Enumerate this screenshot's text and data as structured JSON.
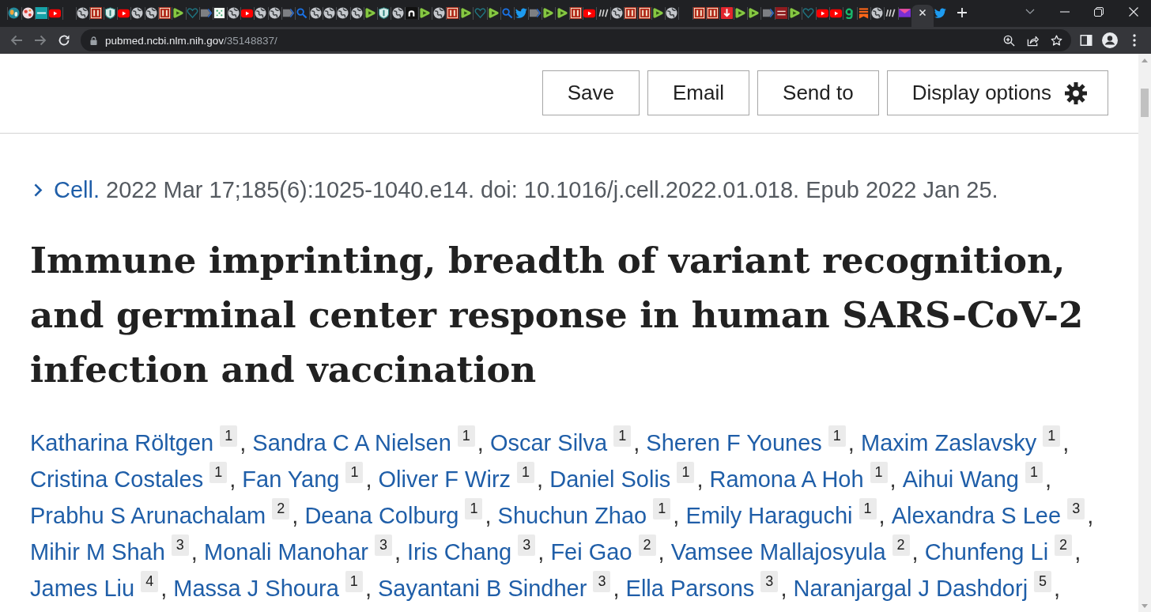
{
  "tabs": [
    {
      "kind": "earth",
      "selected": false
    },
    {
      "kind": "splash",
      "selected": false
    },
    {
      "kind": "stat",
      "selected": false
    },
    {
      "kind": "youtube",
      "selected": false
    },
    {
      "kind": "blank",
      "selected": false
    },
    {
      "kind": "globe",
      "selected": false
    },
    {
      "kind": "bi",
      "selected": false
    },
    {
      "kind": "shield",
      "selected": false
    },
    {
      "kind": "youtube",
      "selected": false
    },
    {
      "kind": "globe",
      "selected": false
    },
    {
      "kind": "globe",
      "selected": false
    },
    {
      "kind": "bi",
      "selected": false
    },
    {
      "kind": "rumble",
      "selected": false
    },
    {
      "kind": "heart",
      "selected": false
    },
    {
      "kind": "tag",
      "selected": false
    },
    {
      "kind": "dots",
      "selected": false
    },
    {
      "kind": "globe",
      "selected": false
    },
    {
      "kind": "youtube",
      "selected": false
    },
    {
      "kind": "globe",
      "selected": false
    },
    {
      "kind": "globe",
      "selected": false
    },
    {
      "kind": "tag",
      "selected": false
    },
    {
      "kind": "magnifier",
      "selected": false
    },
    {
      "kind": "globe",
      "selected": false
    },
    {
      "kind": "globe",
      "selected": false
    },
    {
      "kind": "globe",
      "selected": false
    },
    {
      "kind": "globe",
      "selected": false
    },
    {
      "kind": "rumble",
      "selected": false
    },
    {
      "kind": "shield",
      "selected": false
    },
    {
      "kind": "globe",
      "selected": false
    },
    {
      "kind": "arch",
      "selected": false
    },
    {
      "kind": "rumble",
      "selected": false
    },
    {
      "kind": "globe",
      "selected": false
    },
    {
      "kind": "bi",
      "selected": false
    },
    {
      "kind": "rumble",
      "selected": false
    },
    {
      "kind": "heart",
      "selected": false
    },
    {
      "kind": "rumble",
      "selected": false
    },
    {
      "kind": "magnifier",
      "selected": false
    },
    {
      "kind": "bird",
      "selected": false
    },
    {
      "kind": "tag",
      "selected": false
    },
    {
      "kind": "rumble",
      "selected": false
    },
    {
      "kind": "rumble",
      "selected": false
    },
    {
      "kind": "bi",
      "selected": false
    },
    {
      "kind": "youtube",
      "selected": false
    },
    {
      "kind": "slashes",
      "selected": false
    },
    {
      "kind": "globe",
      "selected": false
    },
    {
      "kind": "bi",
      "selected": false
    },
    {
      "kind": "bi",
      "selected": false
    },
    {
      "kind": "rumble",
      "selected": false
    },
    {
      "kind": "globe",
      "selected": false
    },
    {
      "kind": "blank",
      "selected": false
    },
    {
      "kind": "bi",
      "selected": false
    },
    {
      "kind": "bi",
      "selected": false
    },
    {
      "kind": "arrowtile",
      "selected": false
    },
    {
      "kind": "rumble",
      "selected": false
    },
    {
      "kind": "rumble",
      "selected": false
    },
    {
      "kind": "tag",
      "selected": false
    },
    {
      "kind": "bjc",
      "selected": false
    },
    {
      "kind": "rumble",
      "selected": false
    },
    {
      "kind": "heart",
      "selected": false
    },
    {
      "kind": "youtube",
      "selected": false
    },
    {
      "kind": "youtube",
      "selected": false
    },
    {
      "kind": "hook",
      "selected": false
    },
    {
      "kind": "stripes",
      "selected": false
    },
    {
      "kind": "globe",
      "selected": false
    },
    {
      "kind": "slashes",
      "selected": false
    },
    {
      "kind": "envelope",
      "selected": false
    },
    {
      "selected": true
    },
    {
      "kind": "bird",
      "selected": false
    }
  ],
  "toolbar": {
    "back": {
      "disabled": true
    },
    "forward": {
      "disabled": true
    },
    "url": "pubmed.ncbi.nlm.nih.gov/35148837/"
  },
  "actions": [
    {
      "label": "Save",
      "kind": "plain"
    },
    {
      "label": "Email",
      "kind": "plain"
    },
    {
      "label": "Send to",
      "kind": "plain"
    },
    {
      "label": "Display options",
      "kind": "settings"
    }
  ],
  "citation": {
    "journal": "Cell.",
    "expanded": false,
    "details": "2022 Mar 17;185(6):1025-1040.e14. doi: 10.1016/j.cell.2022.01.018. Epub 2022 Jan 25."
  },
  "title": "Immune imprinting, breadth of variant recognition, and germinal center response in human SARS-CoV-2 infection and vaccination",
  "authors": {
    "separator": ",",
    "items": [
      {
        "name": "Katharina Röltgen",
        "affiliation": "1"
      },
      {
        "name": "Sandra C A Nielsen",
        "affiliation": "1"
      },
      {
        "name": "Oscar Silva",
        "affiliation": "1"
      },
      {
        "name": "Sheren F Younes",
        "affiliation": "1"
      },
      {
        "name": "Maxim Zaslavsky",
        "affiliation": "1"
      },
      {
        "name": "Cristina Costales",
        "affiliation": "1"
      },
      {
        "name": "Fan Yang",
        "affiliation": "1"
      },
      {
        "name": "Oliver F Wirz",
        "affiliation": "1"
      },
      {
        "name": "Daniel Solis",
        "affiliation": "1"
      },
      {
        "name": "Ramona A Hoh",
        "affiliation": "1"
      },
      {
        "name": "Aihui Wang",
        "affiliation": "1"
      },
      {
        "name": "Prabhu S Arunachalam",
        "affiliation": "2"
      },
      {
        "name": "Deana Colburg",
        "affiliation": "1"
      },
      {
        "name": "Shuchun Zhao",
        "affiliation": "1"
      },
      {
        "name": "Emily Haraguchi",
        "affiliation": "1"
      },
      {
        "name": "Alexandra S Lee",
        "affiliation": "3"
      },
      {
        "name": "Mihir M Shah",
        "affiliation": "3"
      },
      {
        "name": "Monali Manohar",
        "affiliation": "3"
      },
      {
        "name": "Iris Chang",
        "affiliation": "3"
      },
      {
        "name": "Fei Gao",
        "affiliation": "2"
      },
      {
        "name": "Vamsee Mallajosyula",
        "affiliation": "2"
      },
      {
        "name": "Chunfeng Li",
        "affiliation": "2"
      },
      {
        "name": "James Liu",
        "affiliation": "4"
      },
      {
        "name": "Massa J Shoura",
        "affiliation": "1"
      },
      {
        "name": "Sayantani B Sindher",
        "affiliation": "3"
      },
      {
        "name": "Ella Parsons",
        "affiliation": "3"
      },
      {
        "name": "Naranjargal J Dashdorj",
        "affiliation": "5"
      }
    ]
  }
}
